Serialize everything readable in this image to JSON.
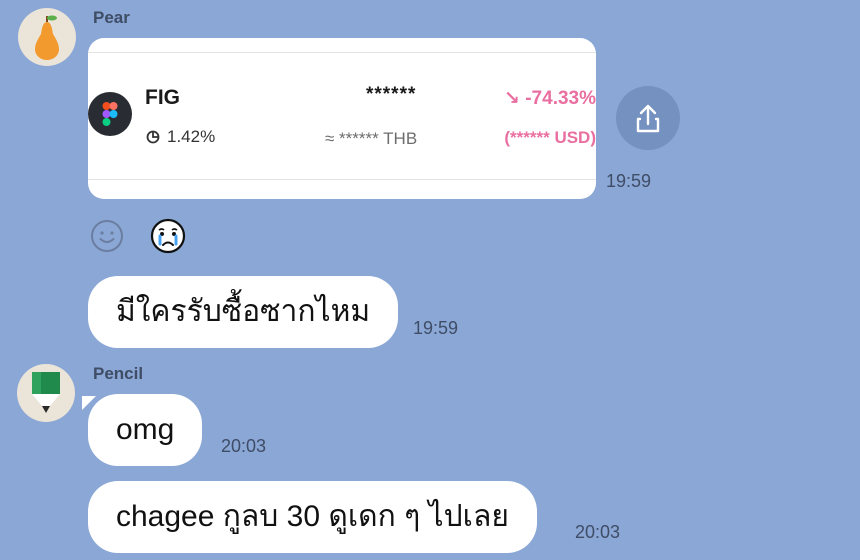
{
  "messages": {
    "pear": {
      "sender": "Pear",
      "card": {
        "symbol": "FIG",
        "price": "******",
        "change_pct": "↘ -74.33%",
        "holding": "1.42%",
        "thb_value": "≈ ****** THB",
        "usd_value": "(****** USD)"
      },
      "card_time": "19:59",
      "text": "มีใครรับซื้อซากไหม",
      "text_time": "19:59"
    },
    "pencil": {
      "sender": "Pencil",
      "msg1": "omg",
      "msg1_time": "20:03",
      "msg2": "chagee กูลบ 30 ดูเดก ๆ ไปเลย",
      "msg2_time": "20:03"
    }
  },
  "icons": {
    "pear_avatar": "pear-icon",
    "pencil_avatar": "pencil-icon",
    "figma_logo": "figma-logo-icon",
    "pie": "pie-chart-icon",
    "share": "share-icon",
    "add_reaction": "smiley-add-reaction-icon",
    "reaction": "crying-face-emoji"
  },
  "colors": {
    "background": "#8aa7d6",
    "negative": "#e96fa0",
    "bubble": "#ffffff"
  }
}
